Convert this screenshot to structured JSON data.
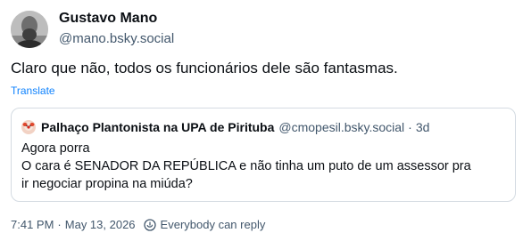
{
  "author": {
    "display_name": "Gustavo Mano",
    "handle": "@mano.bsky.social",
    "avatar_icon": "person-photo-avatar"
  },
  "post": {
    "text": "Claro que não, todos os funcionários dele são fantasmas.",
    "translate_label": "Translate"
  },
  "quote": {
    "display_name": "Palhaço Plantonista na UPA de Pirituba",
    "handle": "@cmopesil.bsky.social",
    "separator": "·",
    "time": "3d",
    "lines": [
      "Agora porra",
      "O cara é SENADOR DA REPÚBLICA e não tinha um puto de um assessor pra",
      "ir negociar propina na miúda?"
    ]
  },
  "footer": {
    "time": "7:41 PM",
    "separator": "·",
    "date": "May 13, 2026",
    "reply_setting_label": "Everybody can reply",
    "reply_icon": "reply-setting-icon"
  },
  "colors": {
    "text": "#0b0f14",
    "muted": "#42576c",
    "link": "#1083fe",
    "border": "#d4dbe2"
  }
}
